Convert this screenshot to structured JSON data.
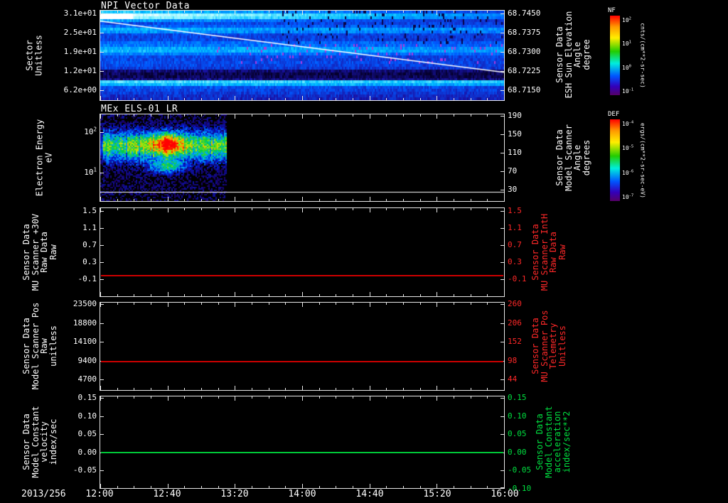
{
  "window": {
    "background": "#000000"
  },
  "x_axis": {
    "date_label": "2013/256",
    "ticks": [
      "12:00",
      "12:40",
      "13:20",
      "14:00",
      "14:40",
      "15:20",
      "16:00"
    ]
  },
  "chart_data": [
    {
      "type": "spectrogram",
      "title": "NPI Vector Data",
      "left_axis": {
        "label_lines": [
          "Sector",
          "Unitless"
        ],
        "ticks": [
          "3.1e+01",
          "2.5e+01",
          "1.9e+01",
          "1.2e+01",
          "6.2e+00"
        ]
      },
      "right_axis": {
        "label_lines": [
          "Sensor Data",
          "ESH Sun Elevation",
          "Angle",
          "degree"
        ],
        "ticks": [
          "68.7450",
          "68.7375",
          "68.7300",
          "68.7225",
          "68.7150"
        ],
        "color": "#ffffff"
      },
      "colorbar": {
        "title": "NF",
        "unit": "cnts/(cm**2-sr-sec)",
        "ticks": [
          "10^2",
          "10^1",
          "10^0",
          "10^-1"
        ]
      },
      "overlay_line": {
        "name": "esh-sun-elevation-angle",
        "color": "#ffffff",
        "start_value": 68.742,
        "end_value": 68.722
      },
      "content_summary": "Blue/cyan horizontal sector bands; bright band near top sectors fading left-to-right; dark band near sector 12 with bright narrow band below it; magenta speckles mid panel; dark speckles upper right; white descending sun-elevation line",
      "x_range": [
        "12:00",
        "16:00"
      ]
    },
    {
      "type": "spectrogram",
      "title": "MEx ELS-01 LR",
      "left_axis": {
        "label_lines": [
          "Electron Energy",
          "eV"
        ],
        "ticks": [
          "10^2",
          "10^1"
        ],
        "scale": "log"
      },
      "right_axis": {
        "label_lines": [
          "Sensor Data",
          "Model Scanner",
          "Angle",
          "degrees"
        ],
        "ticks": [
          "190",
          "150",
          "110",
          "70",
          "30"
        ],
        "color": "#ffffff"
      },
      "colorbar": {
        "title": "DEF",
        "unit": "ergs/(cm**2-sr-sec-eV)",
        "ticks": [
          "10^-4",
          "10^-5",
          "10^-6",
          "10^-7"
        ]
      },
      "data_coverage": {
        "start": "12:00",
        "end": "13:15"
      },
      "content_summary": "Rainbow electron-energy spectrogram from 12:00 to ~13:15 with intense red/yellow core near 12:50 at tens of eV; black (no data) afterwards; thin white baseline near panel bottom",
      "x_range": [
        "12:00",
        "16:00"
      ]
    },
    {
      "type": "line",
      "left_axis": {
        "label_lines": [
          "Sensor Data",
          "MU Scanner +30V",
          "Raw Data",
          "Raw"
        ],
        "ticks": [
          "1.5",
          "1.1",
          "0.7",
          "0.3",
          "-0.1"
        ]
      },
      "right_axis": {
        "label_lines": [
          "Sensor Data",
          "MU Scanner IntH",
          "Raw Data",
          "Raw"
        ],
        "ticks": [
          "1.5",
          "1.1",
          "0.7",
          "0.3",
          "-0.1"
        ],
        "color": "#ff2828"
      },
      "series": [
        {
          "name": "MU Scanner +30V Raw Data",
          "color": "#cc0000",
          "constant_value": 0.0
        }
      ],
      "ylim": [
        -0.5,
        1.5
      ],
      "x_range": [
        "12:00",
        "16:00"
      ]
    },
    {
      "type": "line",
      "left_axis": {
        "label_lines": [
          "Sensor Data",
          "Model Scanner Pos",
          "Raw",
          "unitless"
        ],
        "ticks": [
          "23500",
          "18800",
          "14100",
          "9400",
          "4700"
        ]
      },
      "right_axis": {
        "label_lines": [
          "Sensor Data",
          "MU Scanner Pos",
          "Telemetry",
          "Unitless"
        ],
        "ticks": [
          "260",
          "206",
          "152",
          "98",
          "44"
        ],
        "color": "#ff2828"
      },
      "series": [
        {
          "name": "Model Scanner Pos Raw",
          "color": "#cc0000",
          "constant_value": 9300
        }
      ],
      "right_constant_value": 97,
      "x_range": [
        "12:00",
        "16:00"
      ]
    },
    {
      "type": "line",
      "left_axis": {
        "label_lines": [
          "Sensor Data",
          "Model Constant",
          "velocity",
          "index/sec"
        ],
        "ticks": [
          "0.15",
          "0.10",
          "0.05",
          "0.00",
          "-0.05"
        ]
      },
      "right_axis": {
        "label_lines": [
          "Sensor Data",
          "Model Constant",
          "acceleration",
          "index/sec**2"
        ],
        "ticks": [
          "0.15",
          "0.10",
          "0.05",
          "0.00",
          "-0.05",
          "-0.10"
        ],
        "color": "#00e040"
      },
      "series": [
        {
          "name": "Model Constant velocity",
          "color": "#00c838",
          "constant_value": 0.0
        }
      ],
      "ylim": [
        -0.1,
        0.15
      ],
      "x_range": [
        "12:00",
        "16:00"
      ]
    }
  ]
}
